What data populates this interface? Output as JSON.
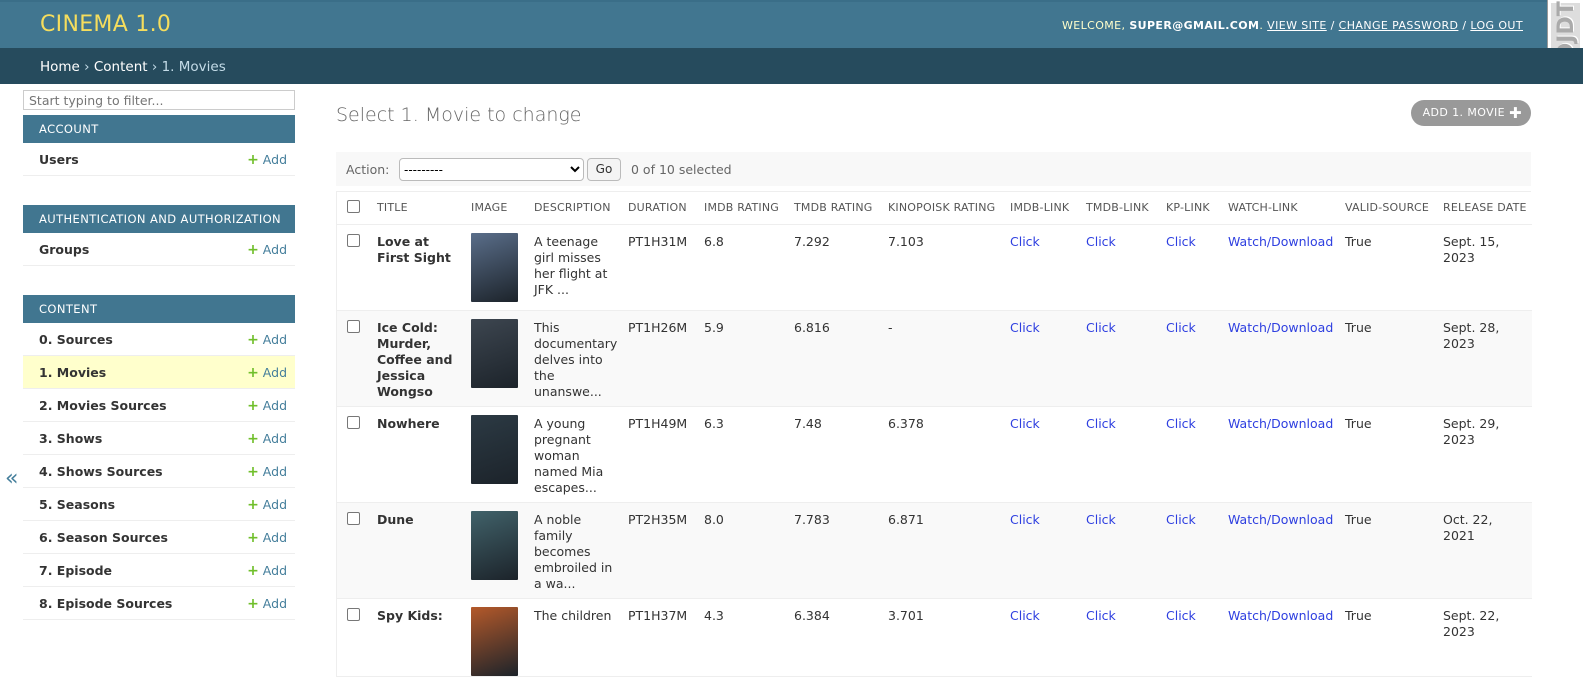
{
  "header": {
    "brand": "CINEMA 1.0",
    "welcome": "WELCOME,",
    "user": "SUPER@GMAIL.COM",
    "view_site": "VIEW SITE",
    "change_password": "CHANGE PASSWORD",
    "log_out": "LOG OUT",
    "sep": "/",
    "toolbar_label": "DJDT"
  },
  "breadcrumbs": {
    "home": "Home",
    "content": "Content",
    "current": "1. Movies",
    "sep": "›"
  },
  "sidebar": {
    "filter_placeholder": "Start typing to filter...",
    "add_label": "Add",
    "toggle": "«",
    "modules": [
      {
        "caption": "Account",
        "models": [
          {
            "name": "Users"
          }
        ]
      },
      {
        "caption": "Authentication and Authorization",
        "models": [
          {
            "name": "Groups"
          }
        ]
      },
      {
        "caption": "Content",
        "models": [
          {
            "name": "0. Sources"
          },
          {
            "name": "1. Movies",
            "current": true
          },
          {
            "name": "2. Movies Sources"
          },
          {
            "name": "3. Shows"
          },
          {
            "name": "4. Shows Sources"
          },
          {
            "name": "5. Seasons"
          },
          {
            "name": "6. Season Sources"
          },
          {
            "name": "7. Episode"
          },
          {
            "name": "8. Episode Sources"
          }
        ]
      }
    ]
  },
  "main": {
    "title": "Select 1. Movie to change",
    "add_button": "ADD 1. MOVIE",
    "actions": {
      "label": "Action:",
      "selected_option": "---------",
      "go": "Go",
      "counter": "0 of 10 selected"
    },
    "columns": [
      "Title",
      "Image",
      "Description",
      "Duration",
      "IMDB Rating",
      "TMDB Rating",
      "Kinopoisk Rating",
      "IMDB-Link",
      "TMDB-Link",
      "KP-Link",
      "Watch-Link",
      "Valid-Source",
      "Release Date"
    ],
    "rows": [
      {
        "title": "Love at First Sight",
        "poster": "#5a6e8a",
        "description": "A teenage girl misses her flight at JFK ...",
        "duration": "PT1H31M",
        "imdb": "6.8",
        "tmdb": "7.292",
        "kp": "7.103",
        "imdb_link": "Click",
        "tmdb_link": "Click",
        "kp_link": "Click",
        "watch_link": "Watch/Download",
        "valid": "True",
        "release": "Sept. 15, 2023"
      },
      {
        "title": "Ice Cold: Murder, Coffee and Jessica Wongso",
        "poster": "#3d4650",
        "description": "This documentary delves into the unanswe...",
        "duration": "PT1H26M",
        "imdb": "5.9",
        "tmdb": "6.816",
        "kp": "-",
        "imdb_link": "Click",
        "tmdb_link": "Click",
        "kp_link": "Click",
        "watch_link": "Watch/Download",
        "valid": "True",
        "release": "Sept. 28, 2023"
      },
      {
        "title": "Nowhere",
        "poster": "#2c3a44",
        "description": "A young pregnant woman named Mia escapes...",
        "duration": "PT1H49M",
        "imdb": "6.3",
        "tmdb": "7.48",
        "kp": "6.378",
        "imdb_link": "Click",
        "tmdb_link": "Click",
        "kp_link": "Click",
        "watch_link": "Watch/Download",
        "valid": "True",
        "release": "Sept. 29, 2023"
      },
      {
        "title": "Dune",
        "poster": "#41626a",
        "description": "A noble family becomes embroiled in a wa...",
        "duration": "PT2H35M",
        "imdb": "8.0",
        "tmdb": "7.783",
        "kp": "6.871",
        "imdb_link": "Click",
        "tmdb_link": "Click",
        "kp_link": "Click",
        "watch_link": "Watch/Download",
        "valid": "True",
        "release": "Oct. 22, 2021"
      },
      {
        "title": "Spy Kids:",
        "poster": "#b4592a",
        "description": "The children",
        "duration": "PT1H37M",
        "imdb": "4.3",
        "tmdb": "6.384",
        "kp": "3.701",
        "imdb_link": "Click",
        "tmdb_link": "Click",
        "kp_link": "Click",
        "watch_link": "Watch/Download",
        "valid": "True",
        "release": "Sept. 22, 2023"
      }
    ]
  }
}
